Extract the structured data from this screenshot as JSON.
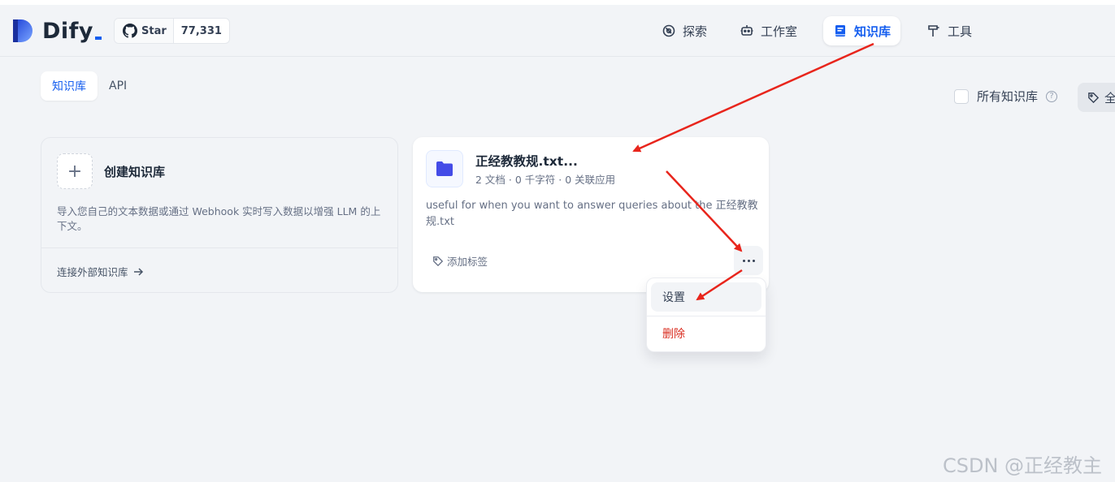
{
  "app": {
    "name": "Dify"
  },
  "github": {
    "star_label": "Star",
    "star_count": "77,331"
  },
  "nav": [
    {
      "label": "探索",
      "icon": "compass-icon"
    },
    {
      "label": "工作室",
      "icon": "robot-icon"
    },
    {
      "label": "知识库",
      "icon": "book-icon",
      "active": true
    },
    {
      "label": "工具",
      "icon": "hammer-icon"
    }
  ],
  "tabs": [
    {
      "label": "知识库",
      "active": true
    },
    {
      "label": "API"
    }
  ],
  "filters": {
    "all_datasets_label": "所有知识库",
    "tag_filter_label": "全"
  },
  "create_card": {
    "title": "创建知识库",
    "description": "导入您自己的文本数据或通过 Webhook 实时写入数据以增强 LLM 的上下文。",
    "link": "连接外部知识库"
  },
  "dataset": {
    "title": "正经教教规.txt...",
    "meta": "2 文档 · 0 千字符 · 0 关联应用",
    "description": "useful for when you want to answer queries about the 正经教教规.txt",
    "add_tag": "添加标签"
  },
  "menu": {
    "settings": "设置",
    "delete": "删除"
  },
  "colors": {
    "accent": "#155eef",
    "danger": "#d92d20",
    "annotation_arrow": "#e8251c"
  },
  "watermark": "CSDN @正经教主"
}
